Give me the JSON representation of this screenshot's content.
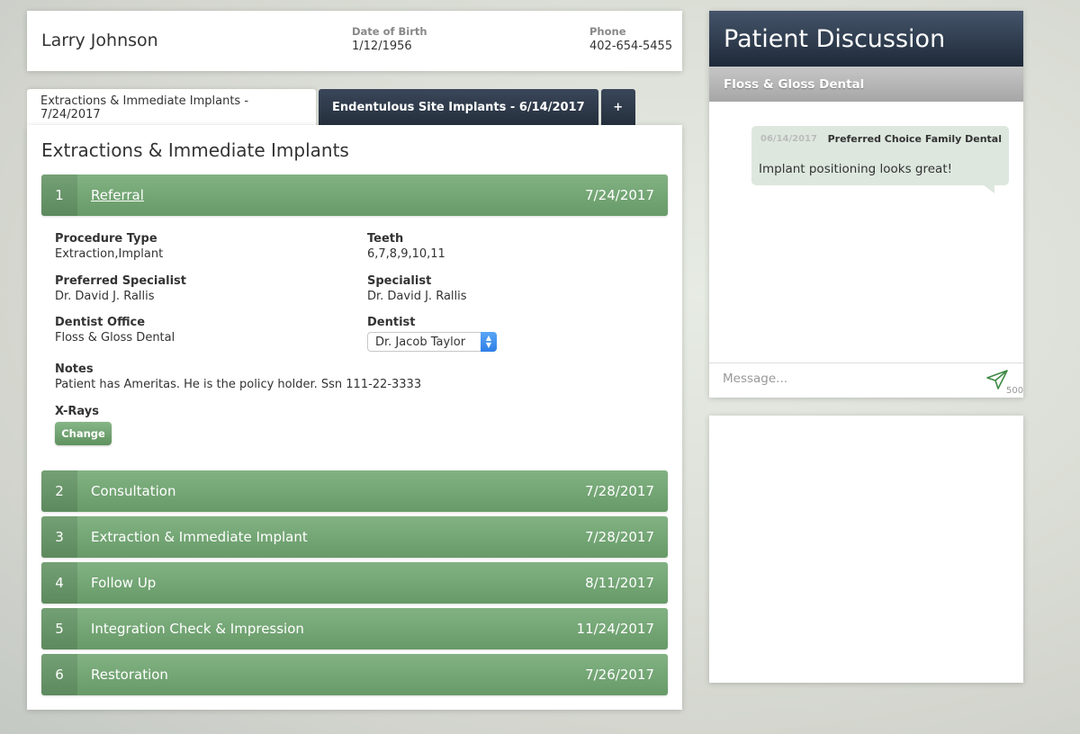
{
  "patient": {
    "name": "Larry Johnson",
    "dob_label": "Date of Birth",
    "dob": "1/12/1956",
    "phone_label": "Phone",
    "phone": "402-654-5455"
  },
  "tabs": [
    {
      "label": "Extractions & Immediate Implants - 7/24/2017",
      "active": true
    },
    {
      "label": "Endentulous Site Implants - 6/14/2017",
      "active": false
    },
    {
      "label": "+",
      "active": false
    }
  ],
  "main": {
    "title": "Extractions & Immediate Implants",
    "steps": [
      {
        "num": "1",
        "label": "Referral",
        "date": "7/24/2017"
      },
      {
        "num": "2",
        "label": "Consultation",
        "date": "7/28/2017"
      },
      {
        "num": "3",
        "label": "Extraction & Immediate Implant",
        "date": "7/28/2017"
      },
      {
        "num": "4",
        "label": "Follow Up",
        "date": "8/11/2017"
      },
      {
        "num": "5",
        "label": "Integration Check & Impression",
        "date": "11/24/2017"
      },
      {
        "num": "6",
        "label": "Restoration",
        "date": "7/26/2017"
      }
    ],
    "referral": {
      "procedure_type_label": "Procedure Type",
      "procedure_type": "Extraction,Implant",
      "teeth_label": "Teeth",
      "teeth": "6,7,8,9,10,11",
      "preferred_specialist_label": "Preferred Specialist",
      "preferred_specialist": "Dr. David J. Rallis",
      "specialist_label": "Specialist",
      "specialist": "Dr. David J. Rallis",
      "dentist_office_label": "Dentist Office",
      "dentist_office": "Floss & Gloss Dental",
      "dentist_label": "Dentist",
      "dentist_selected": "Dr. Jacob Taylor",
      "notes_label": "Notes",
      "notes": "Patient has Ameritas. He is the policy holder. Ssn 111-22-3333",
      "xrays_label": "X-Rays",
      "change_button": "Change"
    }
  },
  "discussion": {
    "title": "Patient Discussion",
    "office": "Floss & Gloss Dental",
    "messages": [
      {
        "date": "06/14/2017",
        "from": "Preferred Choice Family Dental",
        "text": "Implant positioning looks great!"
      }
    ],
    "input_placeholder": "Message...",
    "char_count": "500",
    "send_icon": "paper-plane-icon"
  },
  "colors": {
    "step_green": "#74a775",
    "header_dark": "#2c3848",
    "bubble": "#dde7de",
    "select_blue": "#2e7fe6"
  }
}
